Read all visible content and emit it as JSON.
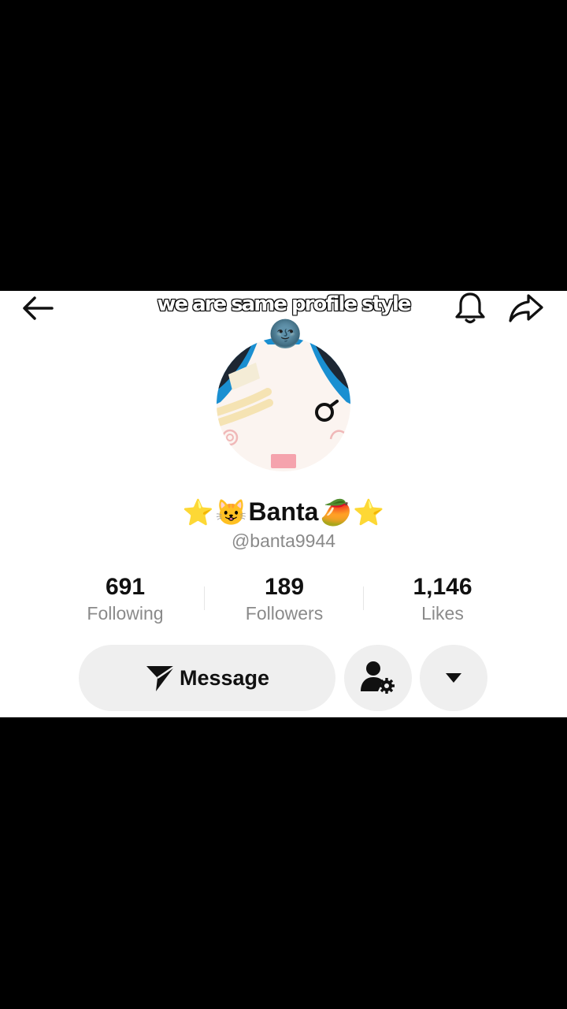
{
  "overlay_caption": "we are same profile style",
  "header": {
    "back_icon": "arrow-left-icon",
    "notification_icon": "bell-icon",
    "share_icon": "share-arrow-icon"
  },
  "profile": {
    "display_name": "Banta",
    "name_emojis_before": [
      "⭐",
      "😺"
    ],
    "name_emojis_after": [
      "🥭",
      "⭐"
    ],
    "handle": "@banta9944",
    "avatar_overlay_emoji": "🌚"
  },
  "stats": [
    {
      "value": "691",
      "label": "Following"
    },
    {
      "value": "189",
      "label": "Followers"
    },
    {
      "value": "1,146",
      "label": "Likes"
    }
  ],
  "actions": {
    "message_label": "Message",
    "message_icon": "send-icon",
    "friends_settings_icon": "user-settings-icon",
    "more_icon": "caret-down-icon"
  },
  "colors": {
    "avatar_blue": "#1a8fd1",
    "button_bg": "#efefef",
    "secondary_text": "#8a8a8a"
  }
}
